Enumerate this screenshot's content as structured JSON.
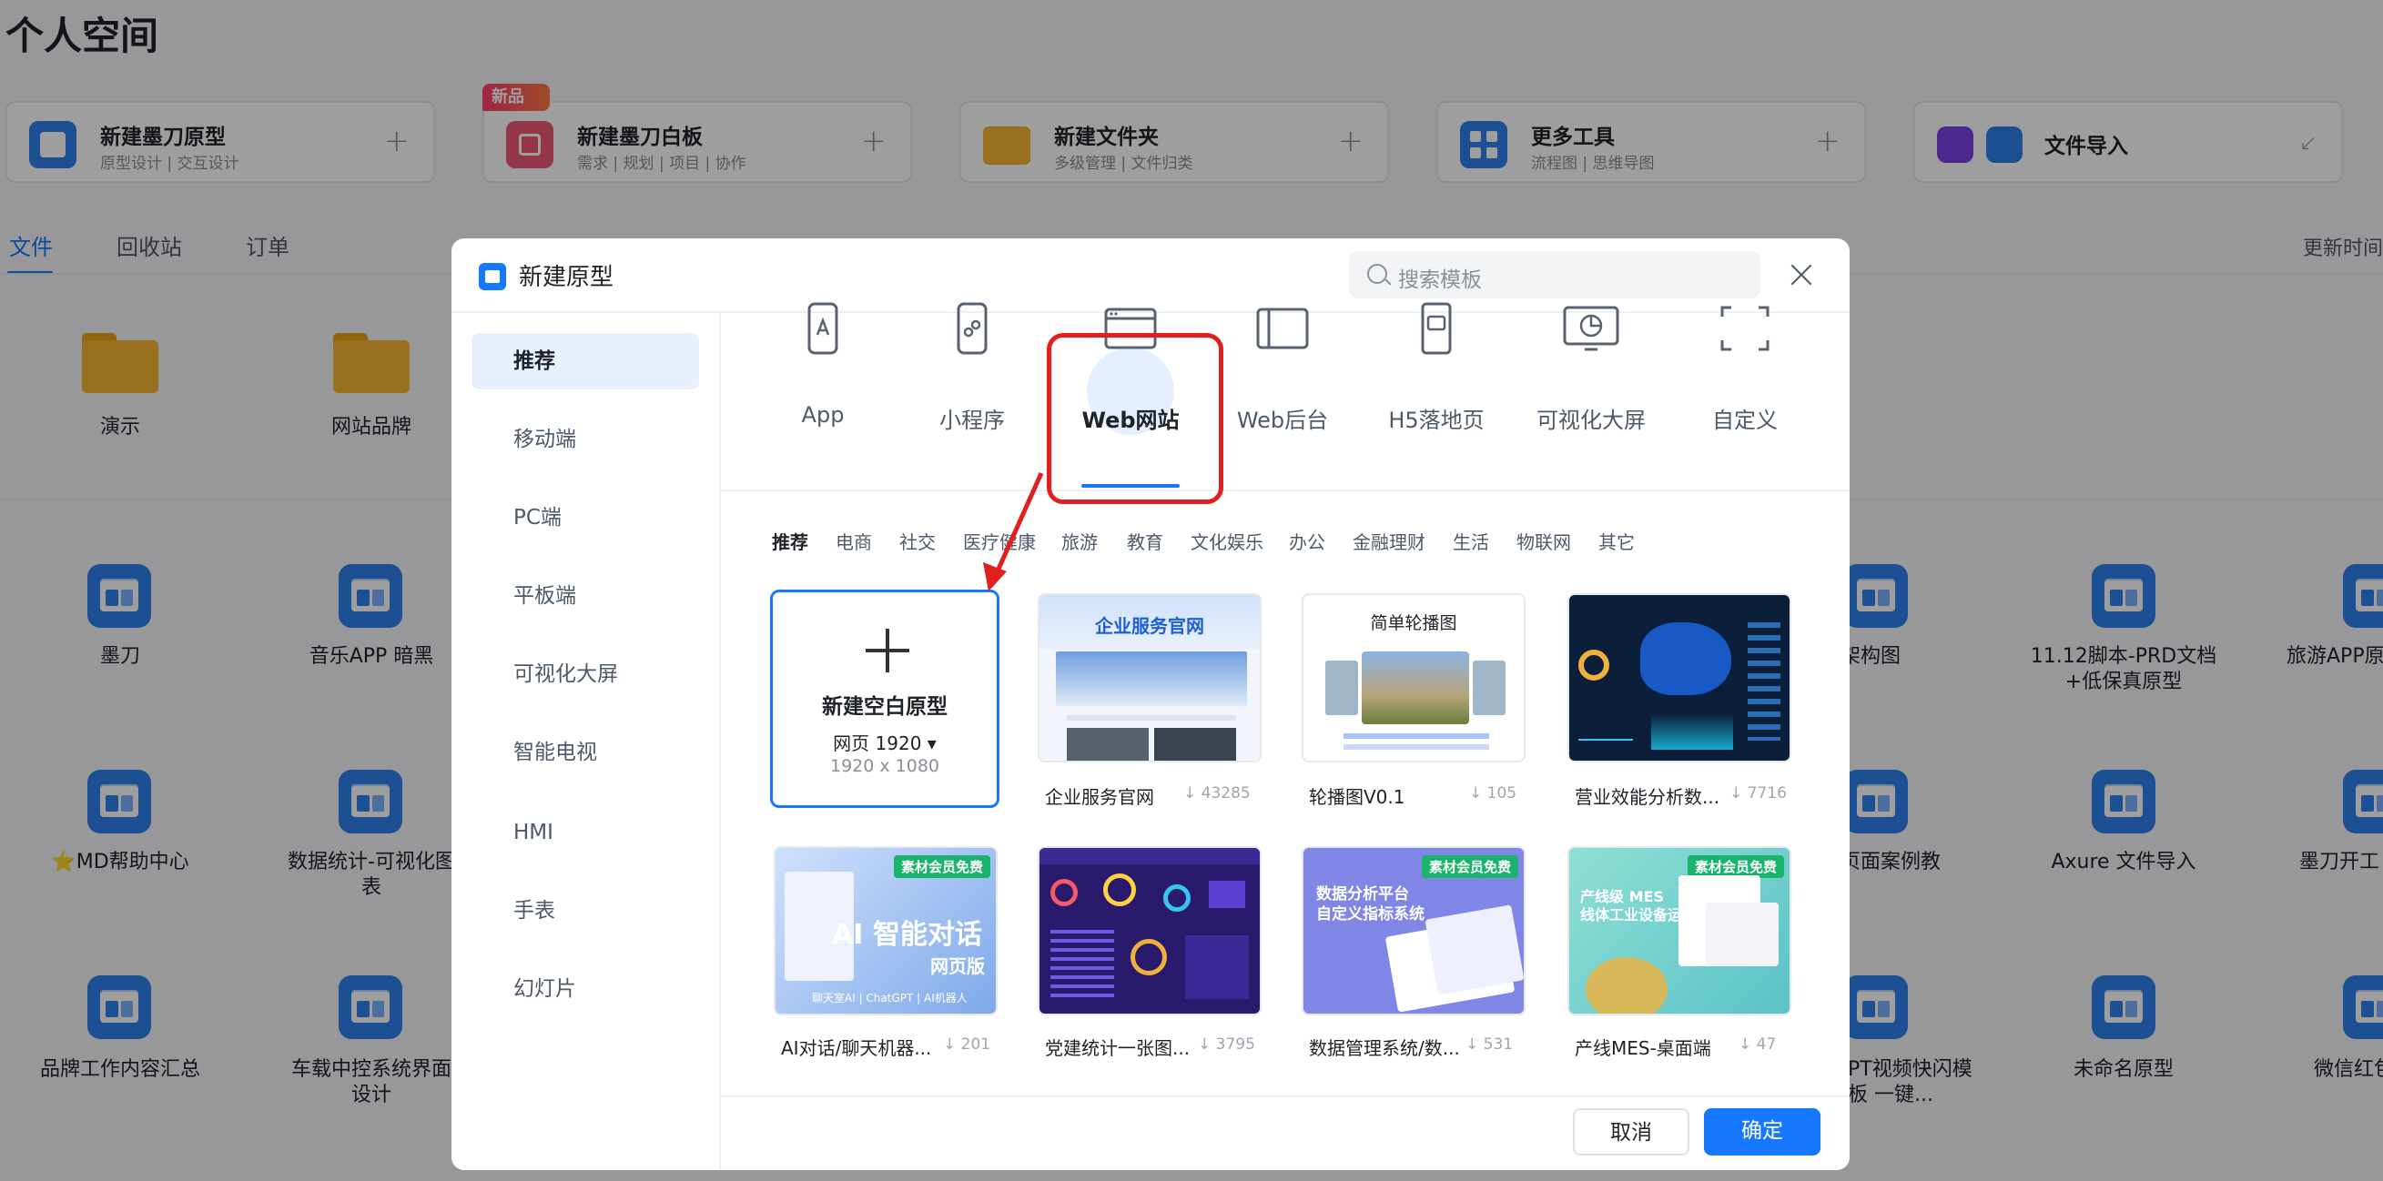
{
  "page": {
    "title": "个人空间",
    "quick_actions": [
      {
        "title": "新建墨刀原型",
        "subtitle": "原型设计 | 交互设计",
        "icon": "prototype-icon"
      },
      {
        "title": "新建墨刀白板",
        "subtitle": "需求 | 规划 | 项目 | 协作",
        "icon": "whiteboard-icon",
        "badge": "新品"
      },
      {
        "title": "新建文件夹",
        "subtitle": "多级管理 | 文件归类",
        "icon": "folder-icon"
      },
      {
        "title": "更多工具",
        "subtitle": "流程图 | 思维导图",
        "icon": "grid-icon"
      },
      {
        "title": "文件导入",
        "subtitle": "",
        "icon": "import-icon"
      }
    ],
    "tabs": [
      "文件",
      "回收站",
      "订单"
    ],
    "sort_label": "更新时间",
    "folders": [
      "演示",
      "网站品牌"
    ],
    "files_left": [
      [
        "墨刀",
        "音乐APP 暗黑"
      ],
      [
        "⭐MD帮助中心",
        "数据统计-可视化图表"
      ],
      [
        "品牌工作内容汇总",
        "车载中控系统界面设计"
      ]
    ],
    "files_right": [
      [
        "能架构图",
        "11.12脚本-PRD文档+低保真原型",
        "旅游APP原"
      ],
      [
        "放页面案例教程",
        "Axure 文件导入",
        "墨刀开工"
      ],
      [
        "PT视频快闪模板 一键...",
        "未命名原型",
        "微信红包"
      ]
    ]
  },
  "modal": {
    "title": "新建原型",
    "search_placeholder": "搜索模板",
    "sidebar": [
      "推荐",
      "移动端",
      "PC端",
      "平板端",
      "可视化大屏",
      "智能电视",
      "HMI",
      "手表",
      "幻灯片"
    ],
    "types": [
      "App",
      "小程序",
      "Web网站",
      "Web后台",
      "H5落地页",
      "可视化大屏",
      "自定义"
    ],
    "active_type": "Web网站",
    "categories": [
      "推荐",
      "电商",
      "社交",
      "医疗健康",
      "旅游",
      "教育",
      "文化娱乐",
      "办公",
      "金融理财",
      "生活",
      "物联网",
      "其它"
    ],
    "blank": {
      "title": "新建空白原型",
      "size_label": "网页 1920 ▾",
      "dims": "1920 x 1080"
    },
    "templates": [
      {
        "name": "企业服务官网",
        "count": "43285",
        "thumb_title": "企业服务官网"
      },
      {
        "name": "轮播图V0.1",
        "count": "105",
        "thumb_title": "简单轮播图"
      },
      {
        "name": "营业效能分析数...",
        "count": "7716"
      },
      {
        "name": "AI对话/聊天机器...",
        "count": "201",
        "thumb_title": "AI 智能对话",
        "thumb_sub": "网页版",
        "thumb_tags": "聊天室AI | ChatGPT | AI机器人",
        "member": "素材会员免费"
      },
      {
        "name": "党建统计一张图...",
        "count": "3795"
      },
      {
        "name": "数据管理系统/数...",
        "count": "531",
        "thumb_title": "数据分析平台",
        "thumb_sub": "自定义指标系统",
        "member": "素材会员免费"
      },
      {
        "name": "产线MES-桌面端",
        "count": "47",
        "thumb_title": "产线级 MES",
        "thumb_sub": "线体工业设备运营",
        "member": "素材会员免费"
      }
    ],
    "cancel": "取消",
    "ok": "确定"
  },
  "colors": {
    "accent": "#1677ff",
    "highlight": "#e02020",
    "member": "#19b36b"
  }
}
